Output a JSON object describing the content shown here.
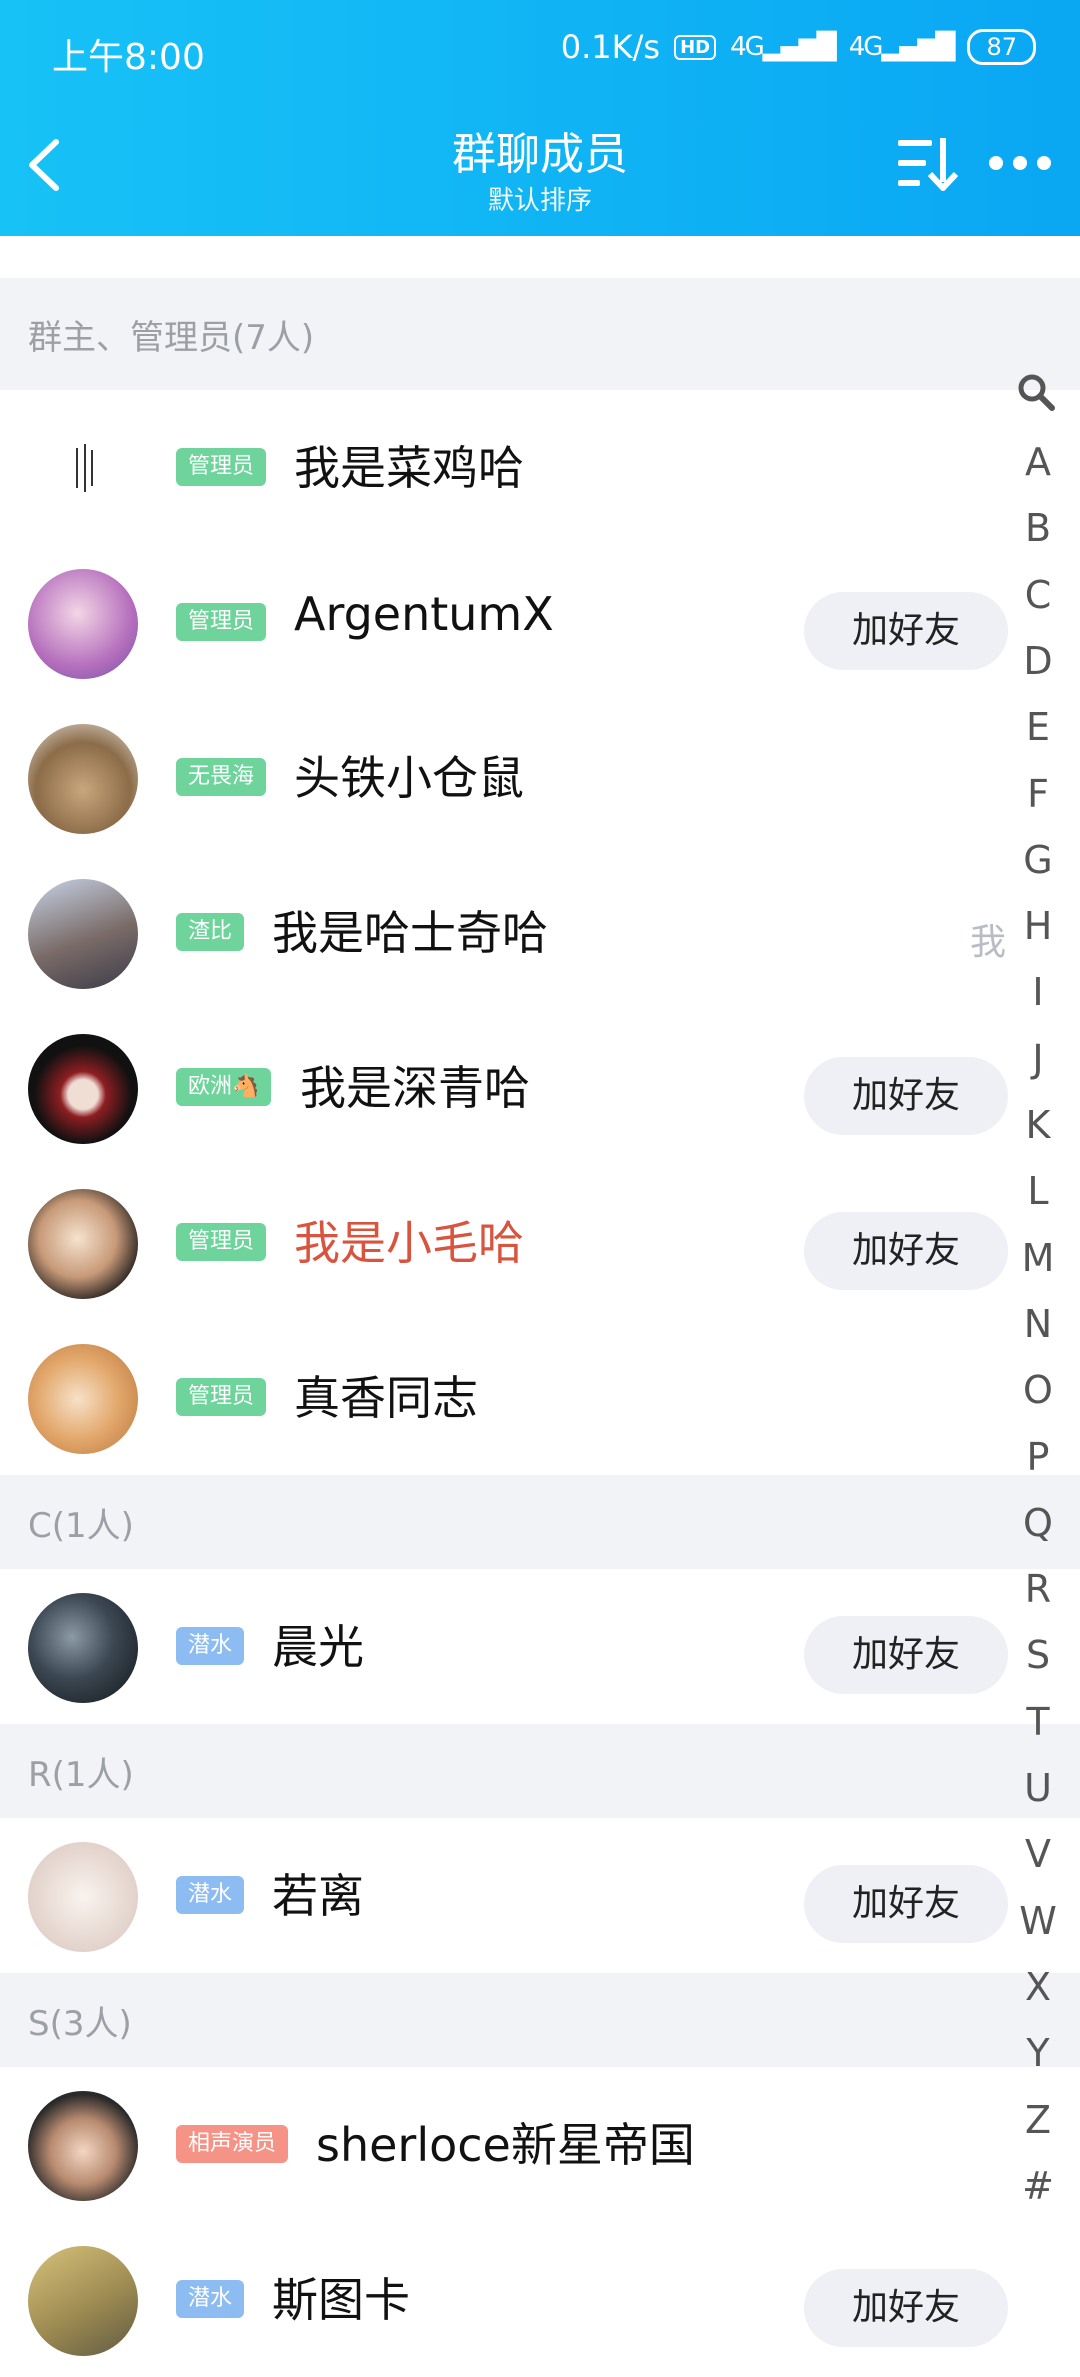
{
  "status": {
    "time": "上午8:00",
    "speed": "0.1K/s",
    "hd": "HD",
    "net1": "4G",
    "net2": "4G",
    "battery": "87"
  },
  "header": {
    "title": "群聊成员",
    "subtitle": "默认排序"
  },
  "sections": {
    "admins": "群主、管理员(7人)",
    "c": "C(1人)",
    "r": "R(1人)",
    "s": "S(3人)"
  },
  "members": [
    {
      "badge": "管理员",
      "name": "我是菜鸡哈",
      "action": ""
    },
    {
      "badge": "管理员",
      "name": "ArgentumX",
      "action": "加好友"
    },
    {
      "badge": "无畏海",
      "name": "头铁小仓鼠",
      "action": ""
    },
    {
      "badge": "渣比",
      "name": "我是哈士奇哈",
      "action": "",
      "me": "我"
    },
    {
      "badge": "欧洲🐴",
      "name": "我是深青哈",
      "action": "加好友"
    },
    {
      "badge": "管理员",
      "name": "我是小毛哈",
      "action": "加好友"
    },
    {
      "badge": "管理员",
      "name": "真香同志",
      "action": ""
    },
    {
      "badge": "潜水",
      "name": "晨光",
      "action": "加好友"
    },
    {
      "badge": "潜水",
      "name": "若离",
      "action": "加好友"
    },
    {
      "badge": "相声演员",
      "name": "sherloce新星帝国",
      "action": ""
    },
    {
      "badge": "潜水",
      "name": "斯图卡",
      "action": "加好友"
    }
  ],
  "index_letters": [
    "A",
    "B",
    "C",
    "D",
    "E",
    "F",
    "G",
    "H",
    "I",
    "J",
    "K",
    "L",
    "M",
    "N",
    "O",
    "P",
    "Q",
    "R",
    "S",
    "T",
    "U",
    "V",
    "W",
    "X",
    "Y",
    "Z",
    "#"
  ],
  "colors": {
    "header": "#0aa7f3",
    "admin_badge": "#6ed49b",
    "lurker_badge": "#8dbcf3",
    "special_badge": "#f59387",
    "highlight_name": "#d9543f"
  }
}
